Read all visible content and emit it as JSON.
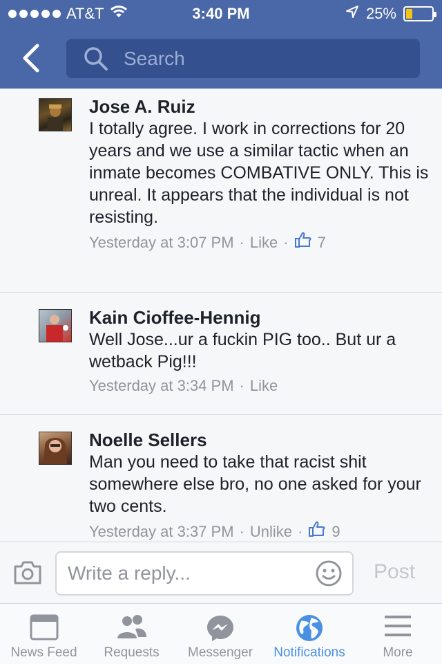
{
  "status_bar": {
    "carrier": "AT&T",
    "time": "3:40 PM",
    "battery": "25%",
    "battery_level": 0.25
  },
  "header": {
    "back_icon": "chevron-left-icon",
    "search_placeholder": "Search"
  },
  "comments": [
    {
      "name": "Jose A. Ruiz",
      "text": "I totally agree. I work in corrections for 20 years and we use a similar tactic when an inmate becomes COMBATIVE ONLY. This is unreal. It appears that the individual is not resisting.",
      "time": "Yesterday at 3:07 PM",
      "action": "Like",
      "likes": "7"
    },
    {
      "name": "Kain Cioffee-Hennig",
      "text": "Well Jose...ur a fuckin PIG too.. But ur a wetback Pig!!!",
      "time": "Yesterday at 3:34 PM",
      "action": "Like"
    },
    {
      "name": "Noelle Sellers",
      "text": "Man you need to take that racist shit somewhere else bro, no one asked for your two cents.",
      "time": "Yesterday at 3:37 PM",
      "action": "Unlike",
      "likes": "9"
    }
  ],
  "reply": {
    "placeholder": "Write a reply...",
    "post_label": "Post"
  },
  "tabs": [
    {
      "label": "News Feed",
      "icon": "news-feed-icon"
    },
    {
      "label": "Requests",
      "icon": "friends-icon"
    },
    {
      "label": "Messenger",
      "icon": "messenger-icon"
    },
    {
      "label": "Notifications",
      "icon": "globe-icon",
      "active": true
    },
    {
      "label": "More",
      "icon": "menu-icon"
    }
  ],
  "colors": {
    "header": "#4a67a7",
    "search_box": "#34508f",
    "active_tab": "#4a90e2",
    "like_blue": "#4a78d0",
    "battery": "#f3c413"
  }
}
